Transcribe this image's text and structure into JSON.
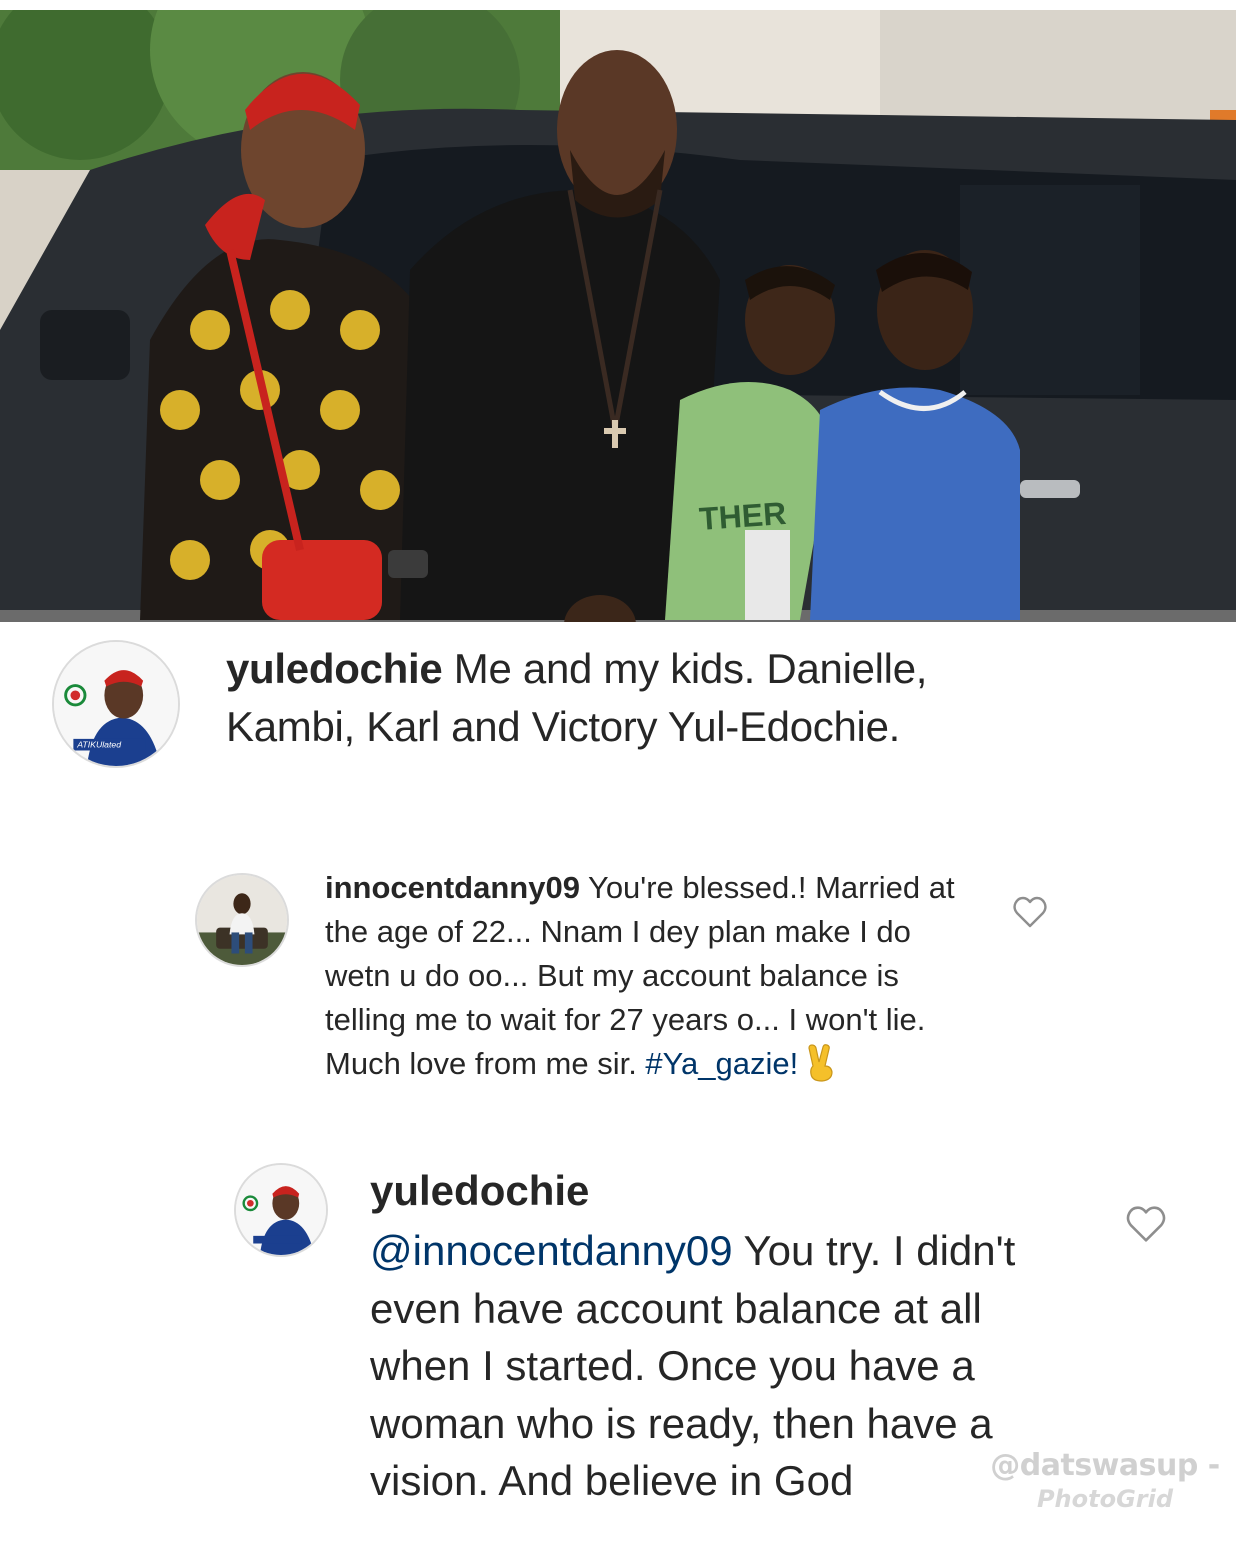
{
  "post": {
    "photo_icon": "family-photo",
    "author": "yuledochie",
    "caption": " Me and my kids. Danielle, Kambi, Karl and Victory Yul-Edochie.",
    "avatar_text": "ATIKUlated"
  },
  "comments": [
    {
      "username": "innocentdanny09",
      "text": " You're blessed.! Married at the age of 22... Nnam I dey plan make I do wetn u do oo... But my account balance is telling me to wait for 27 years o... I won't lie. Much  love from me sir. ",
      "hashtag": "#Ya_gazie!",
      "emoji": "victory-hand",
      "like_icon": "heart-outline-icon"
    }
  ],
  "reply": {
    "username": "yuledochie",
    "mention": "@innocentdanny09",
    "text": " You try. I didn't even have account balance at all when I started. Once you have a woman who is ready, then have a vision. And believe in God",
    "like_icon": "heart-outline-icon"
  },
  "watermark": {
    "handle": "@datswasup -",
    "app": "PhotoGrid"
  },
  "colors": {
    "text": "#262626",
    "link": "#003569",
    "heart_outline": "#8e8e8e"
  }
}
